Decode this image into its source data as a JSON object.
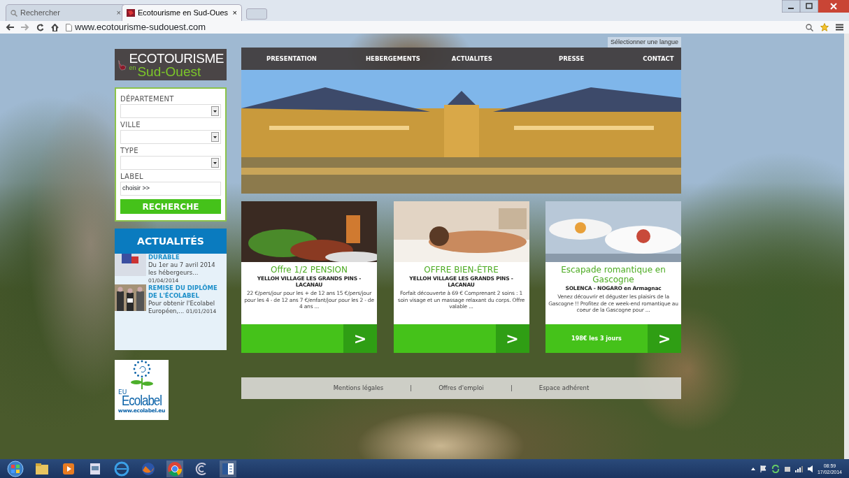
{
  "browser": {
    "tabs": [
      {
        "title": "Rechercher",
        "close": "×",
        "selected": false
      },
      {
        "title": "Ecotourisme en Sud-Oues",
        "close": "×",
        "selected": true
      }
    ],
    "url": "www.ecotourisme-sudouest.com"
  },
  "language_selector": "Sélectionner une langue",
  "logo": {
    "line_1": "ECOTOURISME",
    "line_2a": "en",
    "line_2b": "Sud-Ouest"
  },
  "search_form": {
    "fields": [
      {
        "label": "DÉPARTEMENT",
        "kind": "select"
      },
      {
        "label": "VILLE",
        "kind": "select"
      },
      {
        "label": "TYPE",
        "kind": "select"
      },
      {
        "label": "LABEL",
        "kind": "text",
        "value": "choisir >>"
      }
    ],
    "button": "RECHERCHE"
  },
  "news": {
    "title": "ACTUALITÉS",
    "items": [
      {
        "title": "DURABLE",
        "text": "Du 1er au 7 avril 2014 les hébergeurs...",
        "date": "01/04/2014"
      },
      {
        "title": "REMISE DU DIPLÔME DE L'ÉCOLABEL",
        "text": "Pour obtenir l'Ecolabel Européen,...",
        "date": "01/01/2014"
      }
    ]
  },
  "ecolabel": {
    "eu": "EU",
    "name": "Ecolabel",
    "url": "www.ecolabel.eu"
  },
  "nav": [
    {
      "label": "PRESENTATION"
    },
    {
      "label": "HEBERGEMENTS"
    },
    {
      "label": "ACTUALITES"
    },
    {
      "label": "PRESSE"
    },
    {
      "label": "CONTACT"
    }
  ],
  "offers": [
    {
      "title": "Offre 1/2 PENSION",
      "place": "YELLOH VILLAGE LES GRANDS PINS - LACANAU",
      "text": "22 €/pers/jour pour les + de 12 ans 15 €/pers/jour pour les 4 - de 12 ans  7 €/enfant/jour pour les 2 - de 4 ans ...",
      "arrow": ">"
    },
    {
      "title": "OFFRE BIEN-ÊTRE",
      "place": "YELLOH VILLAGE LES GRANDS PINS - LACANAU",
      "text": "Forfait découverte à 69 € Comprenant 2 soins : 1 soin visage et un massage relaxant du corps. Offre valable ...",
      "arrow": ">"
    },
    {
      "title": "Escapade romantique en Gascogne",
      "place": "SOLENCA - NOGARO",
      "place_note": "en Armagnac",
      "text": "Venez découvrir et déguster les plaisirs de la Gascogne !! Profitez de ce week-end romantique au coeur de la Gascogne pour ...",
      "price": "198€ les 3 jours",
      "arrow": ">"
    }
  ],
  "footer": {
    "links": [
      "Mentions légales",
      "Offres d'emploi",
      "Espace adhérent"
    ],
    "separators": [
      "|",
      "|"
    ]
  },
  "clock": {
    "time": "08:59",
    "date": "17/02/2014"
  }
}
